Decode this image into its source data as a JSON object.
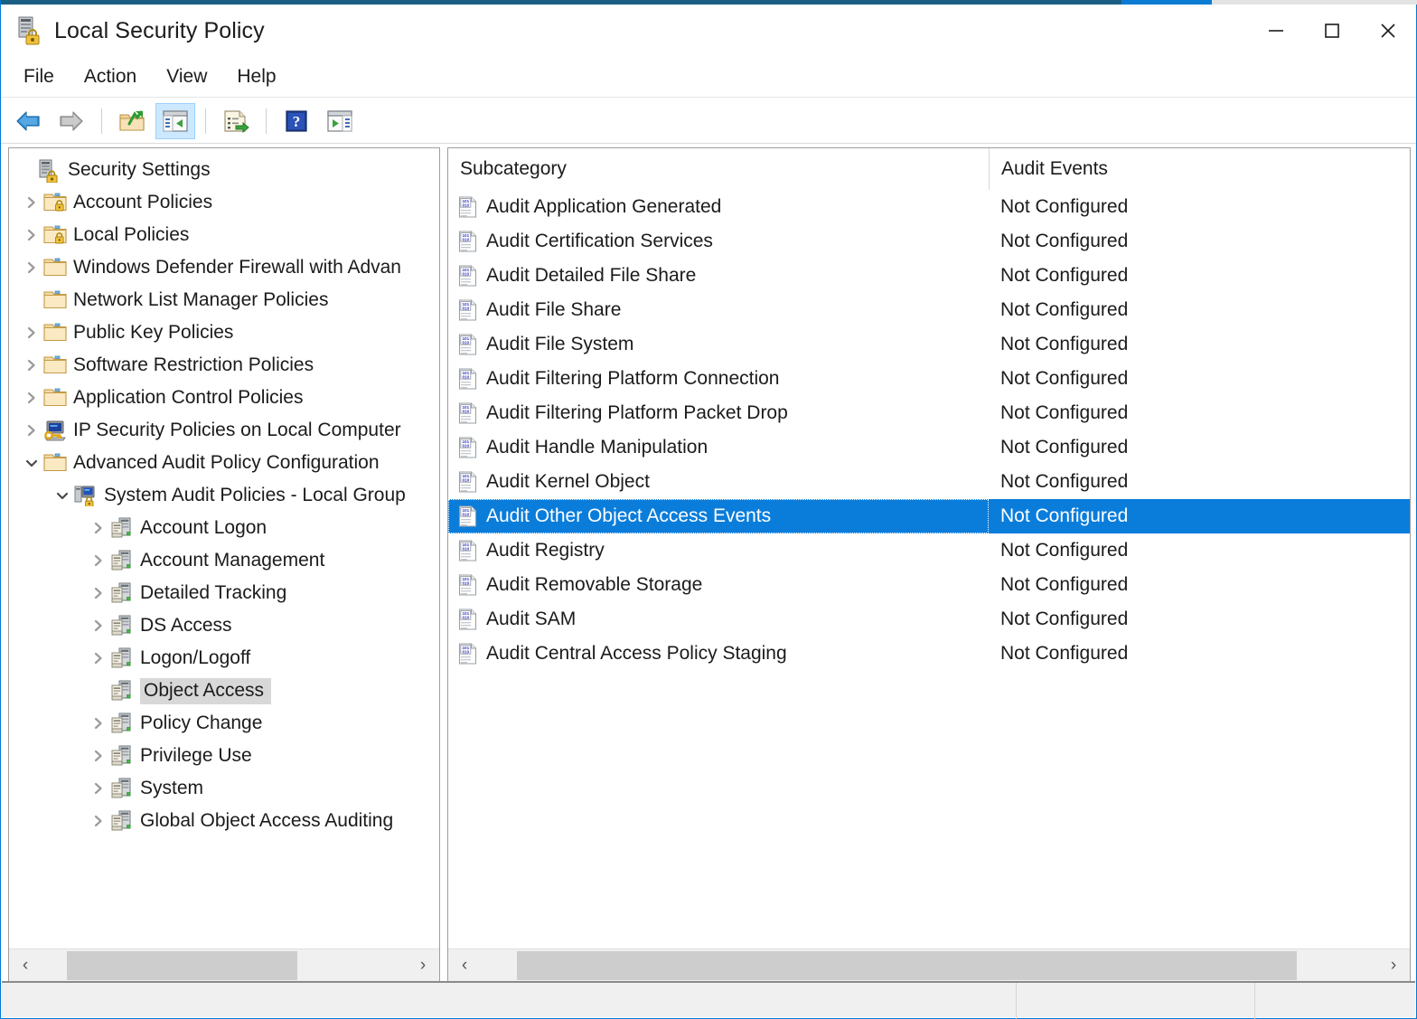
{
  "window": {
    "title": "Local Security Policy",
    "title_icon": "security-policy-icon",
    "minimize_label": "Minimize",
    "maximize_label": "Maximize",
    "close_label": "Close",
    "accent_color": "#0b7cd4",
    "border_color": "#1b5f85",
    "selection_color": "#0a7ddb",
    "tree_selection_color": "#d8d8d8"
  },
  "menubar": {
    "items": [
      {
        "label": "File",
        "name": "menu-file"
      },
      {
        "label": "Action",
        "name": "menu-action"
      },
      {
        "label": "View",
        "name": "menu-view"
      },
      {
        "label": "Help",
        "name": "menu-help"
      }
    ]
  },
  "toolbar": {
    "buttons": [
      {
        "icon": "back-arrow-icon",
        "label": "Back",
        "active": false
      },
      {
        "icon": "forward-arrow-icon",
        "label": "Forward",
        "active": false
      },
      {
        "icon": "up-folder-icon",
        "label": "Up One Level",
        "active": false
      },
      {
        "icon": "show-console-tree-icon",
        "label": "Show/Hide Console Tree",
        "active": true
      },
      {
        "icon": "export-list-icon",
        "label": "Export List",
        "active": false
      },
      {
        "icon": "help-icon",
        "label": "Help",
        "active": false
      },
      {
        "icon": "show-action-pane-icon",
        "label": "Show/Hide Action Pane",
        "active": false
      }
    ]
  },
  "tree": {
    "nodes": [
      {
        "label": "Security Settings",
        "indent": 0,
        "twisty": "none",
        "icon": "security-settings-icon",
        "selected": false
      },
      {
        "label": "Account Policies",
        "indent": 1,
        "twisty": "collapsed",
        "icon": "folder-lock-icon",
        "selected": false
      },
      {
        "label": "Local Policies",
        "indent": 1,
        "twisty": "collapsed",
        "icon": "folder-lock-icon",
        "selected": false
      },
      {
        "label": "Windows Defender Firewall with Advan",
        "indent": 1,
        "twisty": "collapsed",
        "icon": "folder-icon",
        "selected": false
      },
      {
        "label": "Network List Manager Policies",
        "indent": 1,
        "twisty": "none",
        "icon": "folder-icon",
        "selected": false
      },
      {
        "label": "Public Key Policies",
        "indent": 1,
        "twisty": "collapsed",
        "icon": "folder-icon",
        "selected": false
      },
      {
        "label": "Software Restriction Policies",
        "indent": 1,
        "twisty": "collapsed",
        "icon": "folder-icon",
        "selected": false
      },
      {
        "label": "Application Control Policies",
        "indent": 1,
        "twisty": "collapsed",
        "icon": "folder-icon",
        "selected": false
      },
      {
        "label": "IP Security Policies on Local Computer",
        "indent": 1,
        "twisty": "collapsed",
        "icon": "ip-security-icon",
        "selected": false
      },
      {
        "label": "Advanced Audit Policy Configuration",
        "indent": 1,
        "twisty": "expanded",
        "icon": "folder-icon",
        "selected": false
      },
      {
        "label": "System Audit Policies - Local Group",
        "indent": 2,
        "twisty": "expanded",
        "icon": "system-audit-icon",
        "selected": false
      },
      {
        "label": "Account Logon",
        "indent": 3,
        "twisty": "collapsed",
        "icon": "audit-category-icon",
        "selected": false
      },
      {
        "label": "Account Management",
        "indent": 3,
        "twisty": "collapsed",
        "icon": "audit-category-icon",
        "selected": false
      },
      {
        "label": "Detailed Tracking",
        "indent": 3,
        "twisty": "collapsed",
        "icon": "audit-category-icon",
        "selected": false
      },
      {
        "label": "DS Access",
        "indent": 3,
        "twisty": "collapsed",
        "icon": "audit-category-icon",
        "selected": false
      },
      {
        "label": "Logon/Logoff",
        "indent": 3,
        "twisty": "collapsed",
        "icon": "audit-category-icon",
        "selected": false
      },
      {
        "label": "Object Access",
        "indent": 3,
        "twisty": "none",
        "icon": "audit-category-icon",
        "selected": true
      },
      {
        "label": "Policy Change",
        "indent": 3,
        "twisty": "collapsed",
        "icon": "audit-category-icon",
        "selected": false
      },
      {
        "label": "Privilege Use",
        "indent": 3,
        "twisty": "collapsed",
        "icon": "audit-category-icon",
        "selected": false
      },
      {
        "label": "System",
        "indent": 3,
        "twisty": "collapsed",
        "icon": "audit-category-icon",
        "selected": false
      },
      {
        "label": "Global Object Access Auditing",
        "indent": 3,
        "twisty": "collapsed",
        "icon": "audit-category-icon",
        "selected": false
      }
    ],
    "scrollbar": {
      "left_arrow": "‹",
      "right_arrow": "›",
      "thumb_left_pct": 7,
      "thumb_width_pct": 63
    }
  },
  "listview": {
    "columns": [
      {
        "label": "Subcategory",
        "name": "column-subcategory"
      },
      {
        "label": "Audit Events",
        "name": "column-audit-events"
      }
    ],
    "rows": [
      {
        "subcategory": "Audit Application Generated",
        "audit_events": "Not Configured",
        "icon": "audit-subcategory-icon",
        "selected": false
      },
      {
        "subcategory": "Audit Certification Services",
        "audit_events": "Not Configured",
        "icon": "audit-subcategory-icon",
        "selected": false
      },
      {
        "subcategory": "Audit Detailed File Share",
        "audit_events": "Not Configured",
        "icon": "audit-subcategory-icon",
        "selected": false
      },
      {
        "subcategory": "Audit File Share",
        "audit_events": "Not Configured",
        "icon": "audit-subcategory-icon",
        "selected": false
      },
      {
        "subcategory": "Audit File System",
        "audit_events": "Not Configured",
        "icon": "audit-subcategory-icon",
        "selected": false
      },
      {
        "subcategory": "Audit Filtering Platform Connection",
        "audit_events": "Not Configured",
        "icon": "audit-subcategory-icon",
        "selected": false
      },
      {
        "subcategory": "Audit Filtering Platform Packet Drop",
        "audit_events": "Not Configured",
        "icon": "audit-subcategory-icon",
        "selected": false
      },
      {
        "subcategory": "Audit Handle Manipulation",
        "audit_events": "Not Configured",
        "icon": "audit-subcategory-icon",
        "selected": false
      },
      {
        "subcategory": "Audit Kernel Object",
        "audit_events": "Not Configured",
        "icon": "audit-subcategory-icon",
        "selected": false
      },
      {
        "subcategory": "Audit Other Object Access Events",
        "audit_events": "Not Configured",
        "icon": "audit-subcategory-icon",
        "selected": true
      },
      {
        "subcategory": "Audit Registry",
        "audit_events": "Not Configured",
        "icon": "audit-subcategory-icon",
        "selected": false
      },
      {
        "subcategory": "Audit Removable Storage",
        "audit_events": "Not Configured",
        "icon": "audit-subcategory-icon",
        "selected": false
      },
      {
        "subcategory": "Audit SAM",
        "audit_events": "Not Configured",
        "icon": "audit-subcategory-icon",
        "selected": false
      },
      {
        "subcategory": "Audit Central Access Policy Staging",
        "audit_events": "Not Configured",
        "icon": "audit-subcategory-icon",
        "selected": false
      }
    ],
    "scrollbar": {
      "left_arrow": "‹",
      "right_arrow": "›",
      "thumb_left_pct": 4,
      "thumb_width_pct": 87
    }
  },
  "statusbar": {
    "text": ""
  }
}
